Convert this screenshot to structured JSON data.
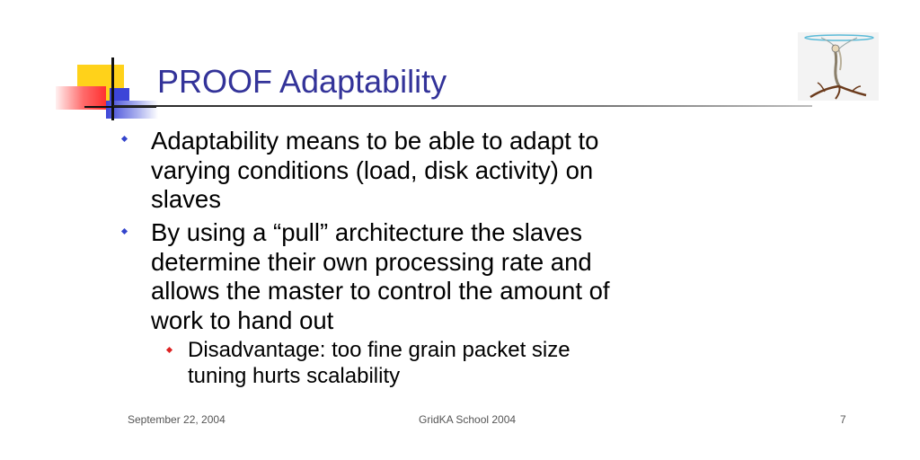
{
  "slide": {
    "title": "PROOF Adaptability",
    "bullets": [
      {
        "lines": [
          "Adaptability means to be able to adapt to",
          "varying conditions (load, disk activity) on",
          "slaves"
        ]
      },
      {
        "lines": [
          "By using a “pull” architecture the slaves",
          "determine their own processing rate and",
          "allows the master to control the amount of",
          "work to hand out"
        ]
      }
    ],
    "sub_bullet": {
      "lines": [
        "Disadvantage: too fine grain packet size",
        "tuning hurts scalability"
      ]
    }
  },
  "footer": {
    "date": "September 22, 2004",
    "center": "GridKA School 2004",
    "page_number": "7"
  },
  "colors": {
    "title": "#333399",
    "bullet_marker": "#3344cc",
    "sub_bullet_marker": "#dd2222"
  },
  "icons": {
    "logo": "tree-figure-logo"
  }
}
